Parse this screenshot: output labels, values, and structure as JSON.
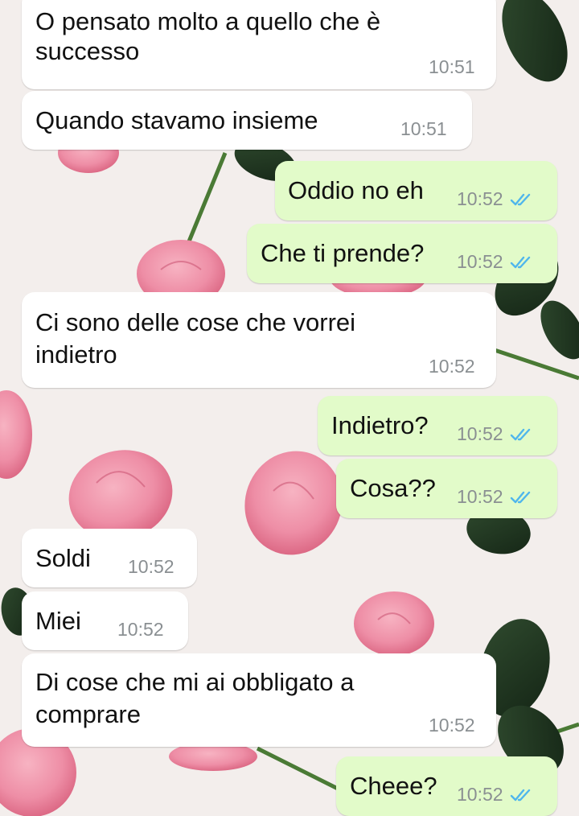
{
  "chat": {
    "messages": [
      {
        "direction": "incoming",
        "lines": [
          "O pensato molto a quello che è",
          "successo"
        ],
        "time": "10:51"
      },
      {
        "direction": "incoming",
        "lines": [
          "Quando stavamo insieme"
        ],
        "time": "10:51"
      },
      {
        "direction": "outgoing",
        "lines": [
          "Oddio no eh"
        ],
        "time": "10:52",
        "status": "read"
      },
      {
        "direction": "outgoing",
        "lines": [
          "Che ti prende?"
        ],
        "time": "10:52",
        "status": "read"
      },
      {
        "direction": "incoming",
        "lines": [
          "Ci sono delle cose che vorrei",
          "indietro"
        ],
        "time": "10:52"
      },
      {
        "direction": "outgoing",
        "lines": [
          "Indietro?"
        ],
        "time": "10:52",
        "status": "read"
      },
      {
        "direction": "outgoing",
        "lines": [
          "Cosa??"
        ],
        "time": "10:52",
        "status": "read"
      },
      {
        "direction": "incoming",
        "lines": [
          "Soldi"
        ],
        "time": "10:52"
      },
      {
        "direction": "incoming",
        "lines": [
          "Miei"
        ],
        "time": "10:52"
      },
      {
        "direction": "incoming",
        "lines": [
          "Di cose che mi ai obbligato a",
          "comprare"
        ],
        "time": "10:52"
      },
      {
        "direction": "outgoing",
        "lines": [
          "Cheee?"
        ],
        "time": "10:52",
        "status": "read"
      }
    ]
  },
  "colors": {
    "incoming_bubble": "#ffffff",
    "outgoing_bubble": "#e2fbc9",
    "read_tick": "#4fb6ec",
    "wallpaper": "#f3eeec"
  },
  "icons": {
    "read_receipt": "double-check-icon",
    "wallpaper": "pink-roses-wallpaper"
  }
}
